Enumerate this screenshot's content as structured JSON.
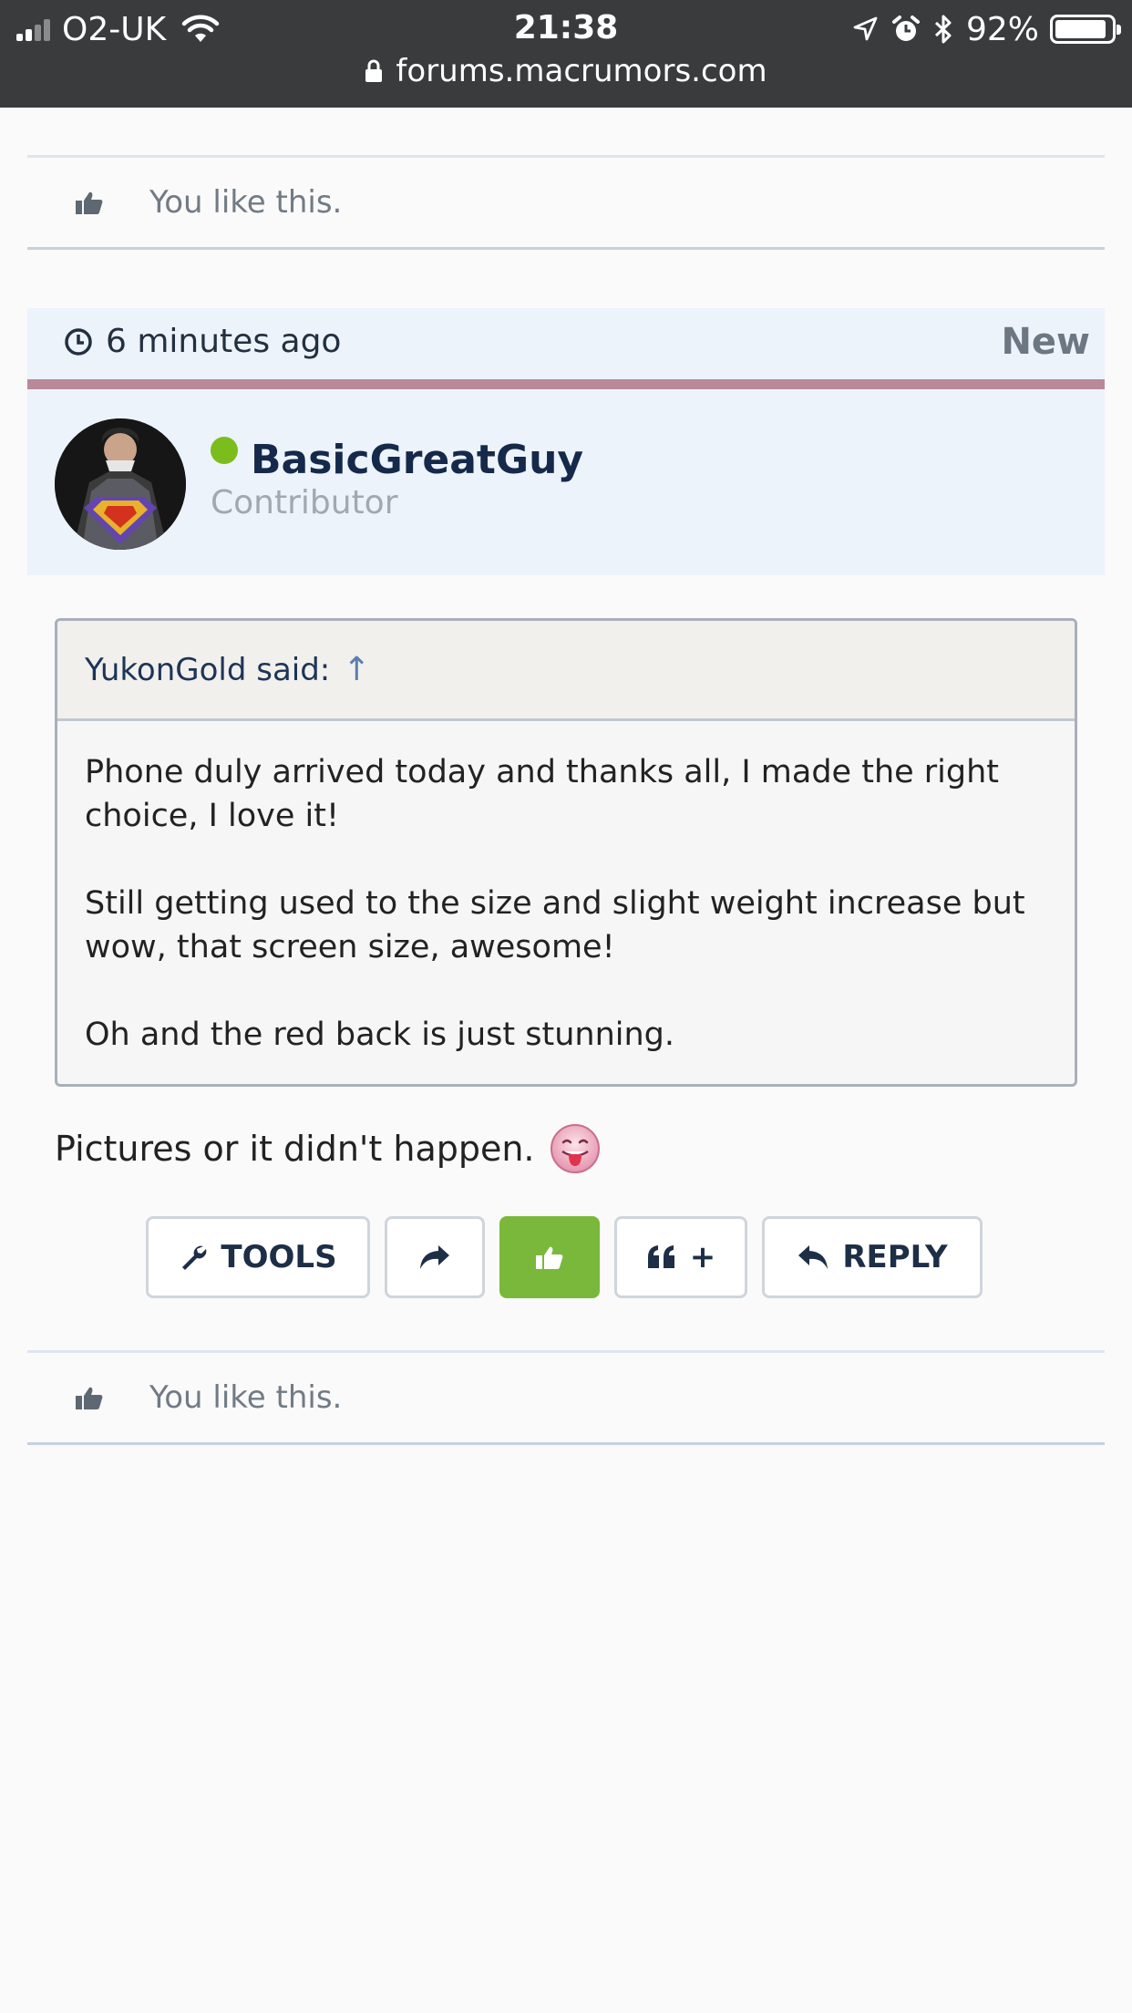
{
  "status_bar": {
    "carrier": "O2-UK",
    "time": "21:38",
    "battery_percent": "92%",
    "battery_level": 0.92,
    "url": "forums.macrumors.com"
  },
  "top_like": {
    "text": "You like this."
  },
  "post": {
    "time": "6 minutes ago",
    "badge": "New",
    "author": {
      "name": "BasicGreatGuy",
      "role": "Contributor",
      "online": true
    },
    "quote": {
      "author": "YukonGold said:",
      "arrow": "↑",
      "paragraphs": [
        "Phone duly arrived today and thanks all, I made the right choice, I love it!",
        "Still getting used to the size and slight weight increase but wow, that screen size, awesome!",
        "Oh and the red back is just stunning."
      ]
    },
    "message": "Pictures or it didn't happen.",
    "actions": {
      "tools": "TOOLS",
      "multiquote": "+",
      "reply": "REPLY"
    }
  },
  "bottom_like": {
    "text": "You like this."
  },
  "colors": {
    "status_bar": "#3a3b3d",
    "header_bg": "#edf3fb",
    "header_accent": "#b9899a",
    "like_green": "#7ab83b",
    "online_green": "#7cbd1e",
    "author_name": "#152a4a"
  }
}
